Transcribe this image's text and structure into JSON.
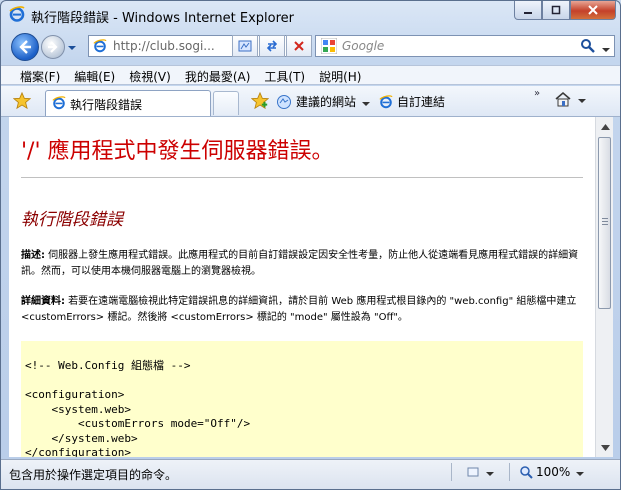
{
  "window": {
    "title": "執行階段錯誤 - Windows Internet Explorer"
  },
  "address_bar": {
    "url": "http://club.sogi..."
  },
  "search": {
    "placeholder": "Google"
  },
  "menu": {
    "items": [
      "檔案(F)",
      "編輯(E)",
      "檢視(V)",
      "我的最愛(A)",
      "工具(T)",
      "說明(H)"
    ]
  },
  "favorites_bar": {
    "tab_label": "執行階段錯誤",
    "suggested_sites": "建議的網站",
    "custom_links": "自訂連結"
  },
  "page": {
    "error_title": "'/' 應用程式中發生伺服器錯誤。",
    "error_subtitle": "執行階段錯誤",
    "desc_label": "描述:",
    "desc_text": " 伺服器上發生應用程式錯誤。此應用程式的目前自訂錯誤設定因安全性考量，防止他人從遠端看見應用程式錯誤的詳細資訊。然而，可以使用本機伺服器電腦上的瀏覽器檢視。",
    "details_label": "詳細資料:",
    "details_text": " 若要在遠端電腦檢視此特定錯誤訊息的詳細資訊，請於目前 Web 應用程式根目錄內的 \"web.config\" 組態檔中建立 <customErrors> 標記。然後將 <customErrors> 標記的 \"mode\" 屬性設為 \"Off\"。",
    "code": "<!-- Web.Config 組態檔 -->\n\n<configuration>\n    <system.web>\n        <customErrors mode=\"Off\"/>\n    </system.web>\n</configuration>"
  },
  "status_bar": {
    "text": "包含用於操作選定項目的命令。",
    "zoom": "100%"
  },
  "colors": {
    "error_title": "#cc0000",
    "error_subtitle": "#8b0000",
    "code_background": "#ffffcc"
  }
}
